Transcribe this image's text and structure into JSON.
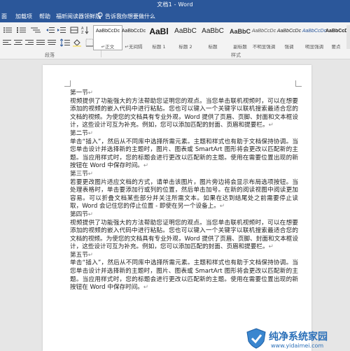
{
  "window": {
    "title": "文档1 - Word"
  },
  "tabs": [
    {
      "label": "面"
    },
    {
      "label": "加载项"
    },
    {
      "label": "帮助"
    },
    {
      "label": "福昕阅读器领鲜版"
    }
  ],
  "tell_me": {
    "placeholder": "告诉我你想要做什么"
  },
  "ribbon": {
    "paragraph_group_label": "段落",
    "styles_group_label": "样式",
    "styles": [
      {
        "preview": "AaBbCcDc",
        "name": "↵正文"
      },
      {
        "preview": "AaBbCcDc",
        "name": "↵无间隔"
      },
      {
        "preview": "AaBl",
        "name": "标题 1"
      },
      {
        "preview": "AaBbC",
        "name": "标题 2"
      },
      {
        "preview": "AaBbC",
        "name": "标题"
      },
      {
        "preview": "AaBbC",
        "name": "副标题"
      },
      {
        "preview": "AaBbCcDc",
        "name": "不明显强调"
      },
      {
        "preview": "AaBbCcDc",
        "name": "强调"
      },
      {
        "preview": "AaBbCcDc",
        "name": "明显强调"
      },
      {
        "preview": "AaBbCcDc",
        "name": "要点"
      }
    ]
  },
  "document": {
    "paragraphs": [
      {
        "text": "第一节",
        "mark": "↵"
      },
      {
        "text": "视频提供了功能强大的方法帮助您证明您的观点。当您单击联机视频时，可以在想要添加的视频的嵌入代码中进行粘贴。您也可以键入一个关键字以联机搜索最适合您的文档的视频。为使您的文档具有专业外观，Word 提供了页眉、页脚、封面和文本框设计，这些设计可互为补充。例如，您可以添加匹配的封面、页眉和提要栏。",
        "mark": "↵"
      },
      {
        "text": "第二节",
        "mark": "↵"
      },
      {
        "text": "单击“插入”，然后从不同库中选择所需元素。主题和样式也有助于文档保持协调。当您单击设计并选择新的主题时，图片、图表或 SmartArt 图形将会更改以匹配新的主题。当应用样式时，您的标题会进行更改以匹配新的主题。使用在需要位置出现的新按钮在 Word 中保存时间。",
        "mark": "↵"
      },
      {
        "text": "第三节",
        "mark": "↵"
      },
      {
        "text": "若要更改图片适应文档的方式，请单击该图片，图片旁边将会显示布局选项按钮。当处理表格时，单击要添加行或列的位置，然后单击加号。在新的阅读视图中阅读更加容易。可以折叠文档某些部分并关注所需文本。如果在达到结尾处之前需要停止读取，Word 会记住您的停止位置 - 即使在另一个设备上。",
        "mark": "↵"
      },
      {
        "text": "第四节",
        "mark": "↵"
      },
      {
        "text": "视频提供了功能强大的方法帮助您证明您的观点。当您单击联机视频时，可以在想要添加的视频的嵌入代码中进行粘贴。您也可以键入一个关键字以联机搜索最适合您的文档的视频。为使您的文档具有专业外观，Word 提供了页眉、页脚、封面和文本框设计，这些设计可互为补充。例如，您可以添加匹配的封面、页眉和提要栏。",
        "mark": "↵"
      },
      {
        "text": "第五节",
        "mark": "↵"
      },
      {
        "text": "单击“插入”，然后从不同库中选择所需元素。主题和样式也有助于文档保持协调。当您单击设计并选择新的主题时，图片、图表或 SmartArt 图形将会更改以匹配新的主题。当应用样式时，您的标题会进行更改以匹配新的主题。使用在需要位置出现的新按钮在 Word 中保存时间。",
        "mark": "↵"
      }
    ]
  },
  "watermark": {
    "title": "纯净系统家园",
    "url": "www.yidaimei.com"
  },
  "colors": {
    "title_bar": "#2b579a",
    "ribbon_bg": "#f3f3f3",
    "canvas_bg": "#e6e6e6",
    "watermark_blue": "#2a6fb8"
  }
}
